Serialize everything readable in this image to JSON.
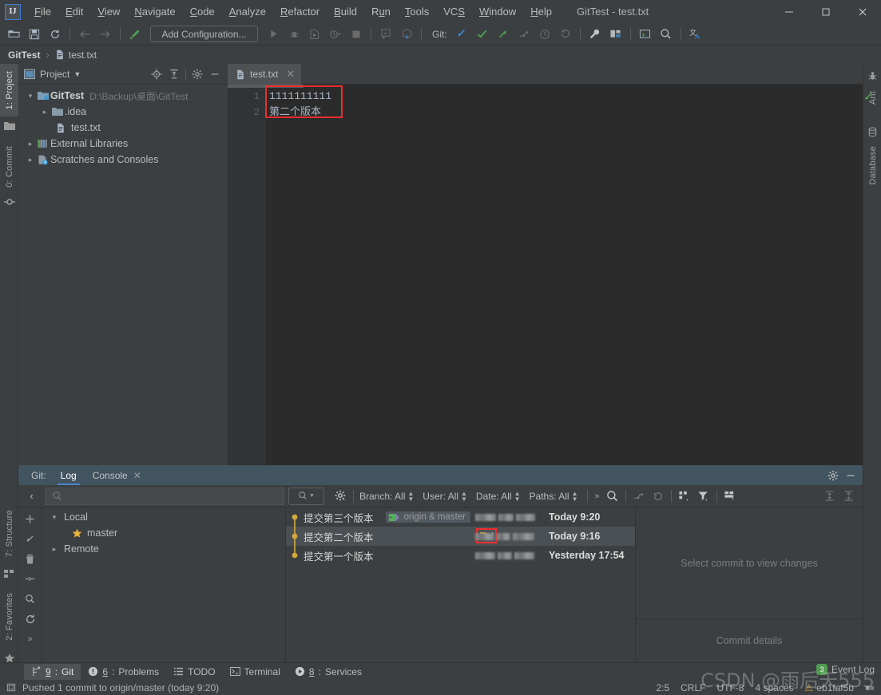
{
  "window": {
    "title": "GitTest - test.txt",
    "logo": "IJ",
    "controls": [
      {
        "name": "minimize",
        "glyph": "—"
      },
      {
        "name": "maximize",
        "glyph": "□"
      },
      {
        "name": "close",
        "glyph": "✕"
      }
    ]
  },
  "menu": [
    {
      "label": "File",
      "mnemonic": "F"
    },
    {
      "label": "Edit",
      "mnemonic": "E"
    },
    {
      "label": "View",
      "mnemonic": "V"
    },
    {
      "label": "Navigate",
      "mnemonic": "N"
    },
    {
      "label": "Code",
      "mnemonic": "C"
    },
    {
      "label": "Analyze",
      "mnemonic": "A"
    },
    {
      "label": "Refactor",
      "mnemonic": "R"
    },
    {
      "label": "Build",
      "mnemonic": "B"
    },
    {
      "label": "Run",
      "mnemonic": "u"
    },
    {
      "label": "Tools",
      "mnemonic": "T"
    },
    {
      "label": "VCS",
      "mnemonic": "S"
    },
    {
      "label": "Window",
      "mnemonic": "W"
    },
    {
      "label": "Help",
      "mnemonic": "H"
    }
  ],
  "toolbar": {
    "run_config_label": "Add Configuration...",
    "git_label": "Git:",
    "icons": [
      "open-folder-icon",
      "save-all-icon",
      "sync-icon",
      "back-arrow-icon",
      "forward-arrow-icon",
      "build-hammer-icon",
      "run-icon",
      "debug-icon",
      "run-with-coverage-icon",
      "profile-dropdown-icon",
      "stop-icon",
      "inspect-icon",
      "deploy-icon",
      "git-update-icon",
      "git-commit-icon",
      "git-push-icon",
      "git-branch-icon",
      "git-history-icon",
      "git-rollback-icon",
      "settings-wrench-icon",
      "project-structure-icon",
      "terminal-icon",
      "search-everywhere-icon",
      "translate-icon"
    ]
  },
  "breadcrumb": {
    "segments": [
      {
        "label": "GitTest",
        "icon": "",
        "bold": true
      },
      {
        "label": "test.txt",
        "icon": "file-icon",
        "bold": false
      }
    ],
    "separator": "›"
  },
  "left_strip": [
    {
      "label": "1: Project",
      "icon": "project-icon",
      "active": true
    },
    {
      "label": "0: Commit",
      "icon": "commit-icon",
      "active": false
    },
    {
      "label": "7: Structure",
      "icon": "structure-icon",
      "active": false
    },
    {
      "label": "2: Favorites",
      "icon": "star-icon",
      "active": false
    }
  ],
  "right_strip": [
    {
      "label": "Ant",
      "icon": "ant-icon"
    },
    {
      "label": "Database",
      "icon": "database-icon"
    }
  ],
  "project_panel": {
    "title": "Project",
    "header_icons": [
      "locate-icon",
      "collapse-all-icon",
      "gear-icon",
      "hide-icon"
    ],
    "tree": [
      {
        "indent": 0,
        "arrow": "⌄",
        "icon": "module-icon",
        "label": "GitTest",
        "bold": true,
        "path": "D:\\Backup\\桌面\\GitTest"
      },
      {
        "indent": 1,
        "arrow": "›",
        "icon": "folder-icon",
        "label": ".idea",
        "bold": false,
        "path": ""
      },
      {
        "indent": 1,
        "arrow": "",
        "icon": "file-icon",
        "label": "test.txt",
        "bold": false,
        "path": ""
      },
      {
        "indent": 0,
        "arrow": "›",
        "icon": "library-icon",
        "label": "External Libraries",
        "bold": false,
        "path": ""
      },
      {
        "indent": 0,
        "arrow": "›",
        "icon": "scratch-icon",
        "label": "Scratches and Consoles",
        "bold": false,
        "path": ""
      }
    ]
  },
  "editor": {
    "tabs": [
      {
        "label": "test.txt",
        "icon": "file-icon",
        "active": true,
        "close": "✕"
      }
    ],
    "lines": [
      {
        "number": "1",
        "text": "1111111111"
      },
      {
        "number": "2",
        "text": "第二个版本"
      }
    ],
    "inspection_ok": "✓"
  },
  "git_panel": {
    "prefix_label": "Git:",
    "tabs": [
      {
        "label": "Log",
        "active": true
      },
      {
        "label": "Console",
        "active": false,
        "close": "✕"
      }
    ],
    "header_icons": [
      "gear-icon",
      "hide-icon"
    ],
    "toolbar": {
      "back_icon": "‹",
      "search_placeholder": "",
      "filters": [
        {
          "label": "Branch: All"
        },
        {
          "label": "User: All"
        },
        {
          "label": "Date: All"
        },
        {
          "label": "Paths: All"
        }
      ],
      "overflow": "»",
      "icons": [
        "search-icon",
        "go-to-hash-icon",
        "refresh-icon",
        "intellisort-icon",
        "filter-icon",
        "show-details-icon",
        "expand-icon",
        "collapse-icon"
      ]
    },
    "side_tools": [
      "add-icon",
      "fetch-icon",
      "delete-icon",
      "collapse-icon",
      "search-icon",
      "refresh-icon",
      "more-icon"
    ],
    "branches": [
      {
        "indent": 0,
        "arrow": "⌄",
        "icon": "",
        "label": "Local"
      },
      {
        "indent": 1,
        "arrow": "",
        "icon": "star-icon",
        "label": "master"
      },
      {
        "indent": 0,
        "arrow": "›",
        "icon": "",
        "label": "Remote"
      }
    ],
    "commits": [
      {
        "message": "提交第三个版本",
        "ref_label": "origin & master",
        "has_ref": true,
        "has_tag": false,
        "date": "Today 9:20",
        "selected": false
      },
      {
        "message": "提交第二个版本",
        "ref_label": "",
        "has_ref": false,
        "has_tag": true,
        "date": "Today 9:16",
        "selected": true
      },
      {
        "message": "提交第一个版本",
        "ref_label": "",
        "has_ref": false,
        "has_tag": false,
        "date": "Yesterday 17:54",
        "selected": false
      }
    ],
    "detail_placeholder": "Select commit to view changes",
    "detail_footer": "Commit details"
  },
  "bottom_tools": [
    {
      "num": "9",
      "label": "Git",
      "icon": "git-branch-icon",
      "active": true
    },
    {
      "num": "6",
      "label": "Problems",
      "icon": "problems-icon",
      "active": false
    },
    {
      "num": "",
      "label": "TODO",
      "icon": "todo-icon",
      "active": false
    },
    {
      "num": "",
      "label": "Terminal",
      "icon": "terminal-icon",
      "active": false
    },
    {
      "num": "8",
      "label": "Services",
      "icon": "services-icon",
      "active": false
    }
  ],
  "status_bar": {
    "message": "Pushed 1 commit to origin/master (today 9:20)",
    "caret": "2:5",
    "line_sep": "CRLF",
    "encoding": "UTF-8",
    "indent": "4 spaces",
    "branch": "eb1faf5b",
    "event_log": "Event Log",
    "event_count": "3"
  },
  "watermark": "CSDN @雨后天555",
  "colors": {
    "bg": "#3c3f41",
    "editor_bg": "#2b2b2b",
    "accent_blue": "#4a88c7",
    "red_highlight": "#ef2d2d",
    "green_ok": "#5ab55a",
    "tag_yellow": "#d4b83a",
    "branch_green": "#4fb05a"
  }
}
